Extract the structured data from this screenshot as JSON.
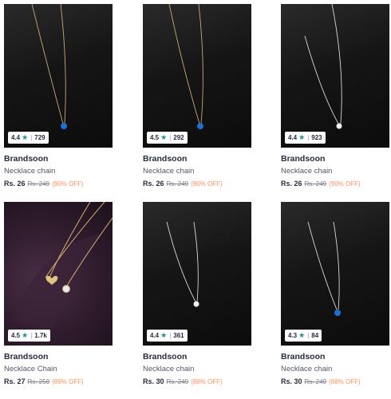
{
  "products": [
    {
      "brand": "Brandsoon",
      "name": "Necklace chain",
      "price": "Rs. 26",
      "mrp": "Rs. 249",
      "discount": "(90% OFF)",
      "rating": "4.4",
      "count": "729",
      "pendant": "blue"
    },
    {
      "brand": "Brandsoon",
      "name": "Necklace chain",
      "price": "Rs. 26",
      "mrp": "Rs. 249",
      "discount": "(90% OFF)",
      "rating": "4.5",
      "count": "292",
      "pendant": "blue"
    },
    {
      "brand": "Brandsoon",
      "name": "Necklace chain",
      "price": "Rs. 26",
      "mrp": "Rs. 249",
      "discount": "(90% OFF)",
      "rating": "4.4",
      "count": "923",
      "pendant": "pearl"
    },
    {
      "brand": "Brandsoon",
      "name": "Necklace Chain",
      "price": "Rs. 27",
      "mrp": "Rs. 250",
      "discount": "(89% OFF)",
      "rating": "4.5",
      "count": "1.7k",
      "pendant": "heart"
    },
    {
      "brand": "Brandsoon",
      "name": "Necklace chain",
      "price": "Rs. 30",
      "mrp": "Rs. 249",
      "discount": "(88% OFF)",
      "rating": "4.4",
      "count": "361",
      "pendant": "pearl"
    },
    {
      "brand": "Brandsoon",
      "name": "Necklace chain",
      "price": "Rs. 30",
      "mrp": "Rs. 249",
      "discount": "(88% OFF)",
      "rating": "4.3",
      "count": "84",
      "pendant": "blue"
    }
  ],
  "icons": {
    "rating": "star-icon"
  },
  "colors": {
    "star": "#14958f",
    "discount": "#ff905a",
    "blue_pendant": "#1f6fd1",
    "pearl": "#f2f2ee",
    "gold": "#c9a877"
  }
}
